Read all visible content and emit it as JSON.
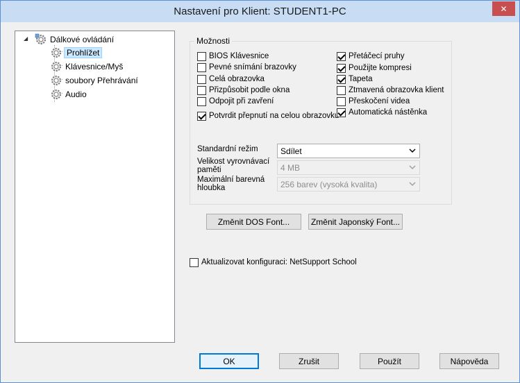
{
  "window": {
    "title": "Nastavení pro Klient: STUDENT1-PC",
    "close_glyph": "✕"
  },
  "tree": {
    "root": {
      "label": "Dálkové ovládání",
      "expander": "◢"
    },
    "items": [
      {
        "label": "Prohlížet",
        "selected": true
      },
      {
        "label": "Klávesnice/Myš",
        "selected": false
      },
      {
        "label": "soubory Přehrávání",
        "selected": false
      },
      {
        "label": "Audio",
        "selected": false
      }
    ]
  },
  "options": {
    "legend": "Možnosti",
    "left": [
      {
        "label": "BIOS Klávesnice",
        "checked": false
      },
      {
        "label": "Pevné snímání brazovky",
        "checked": false
      },
      {
        "label": "Celá obrazovka",
        "checked": false
      },
      {
        "label": "Přizpůsobit podle okna",
        "checked": false
      },
      {
        "label": "Odpojit při zavření",
        "checked": false
      },
      {
        "label": "Potvrdit přepnutí na celou obrazovku",
        "checked": true
      }
    ],
    "right": [
      {
        "label": "Přetáčecí pruhy",
        "checked": true
      },
      {
        "label": "Použijte kompresi",
        "checked": true
      },
      {
        "label": "Tapeta",
        "checked": true
      },
      {
        "label": "Ztmavená obrazovka klient",
        "checked": false
      },
      {
        "label": "Přeskočení videa",
        "checked": false
      },
      {
        "label": "Automatická nástěnka",
        "checked": true
      }
    ],
    "standard_mode": {
      "label": "Standardní režim",
      "value": "Sdílet"
    },
    "cache_size": {
      "label_line1": "Velikost vyrovnávací",
      "label_line2": "paměti",
      "value": "4 MB"
    },
    "color_depth": {
      "label_line1": "Maximální barevná",
      "label_line2": "hloubka",
      "value": "256 barev (vysoká kvalita)"
    }
  },
  "font_buttons": {
    "dos": "Změnit DOS Font...",
    "japanese": "Změnit Japonský Font..."
  },
  "update_config": {
    "label": "Aktualizovat konfiguraci: NetSupport School",
    "checked": false
  },
  "footer": {
    "ok": "OK",
    "cancel": "Zrušit",
    "apply": "Použít",
    "help": "Nápověda"
  }
}
